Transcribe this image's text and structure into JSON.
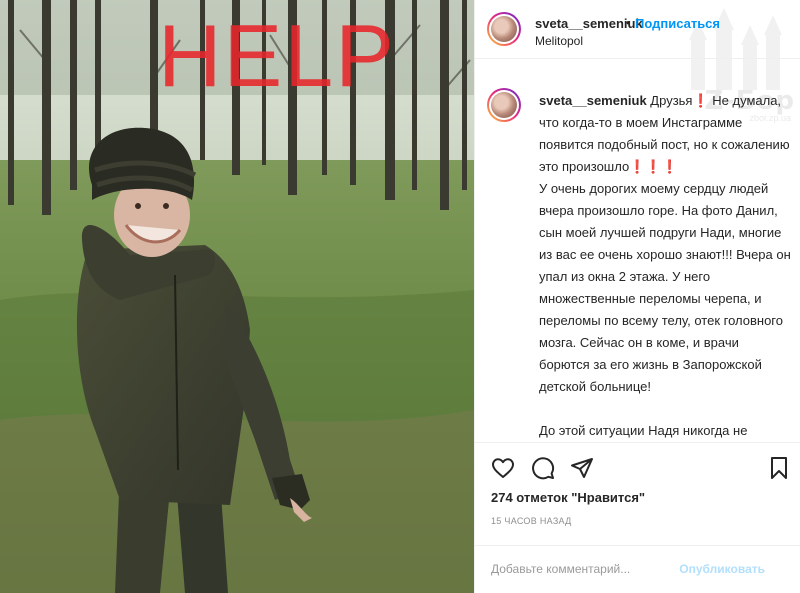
{
  "photo": {
    "overlay_text": "HELP",
    "overlay_color": "#e8262b"
  },
  "header": {
    "username": "sveta__semeniuk",
    "separator": "•",
    "follow_label": "Подписаться",
    "location": "Melitopol"
  },
  "watermark": {
    "logo_text": "Z-Бор",
    "sub_text": "zbor.zp.ua"
  },
  "caption": {
    "username": "sveta__semeniuk",
    "line1_start": " Друзья",
    "line1_rest": " Не думала, что когда-то в моем Инстаграмме появится подобный пост, но к сожалению это произошло",
    "excl": "❗",
    "excl_triple": "❗❗❗",
    "paragraph1_rest": "У очень дорогих моему сердцу людей вчера произошло горе. На фото Данил, сын моей лучшей подруги Нади, многие из вас ее очень хорошо знают!!! Вчера он упал из окна 2 этажа. У него множественные переломы черепа, и переломы по всему телу, отек головного мозга. Сейчас он в коме, и врачи борются за его жизнь в Запорожской детской больнице!",
    "paragraph2": "До этой ситуации Надя никогда не проходила мимо нуждающихся, всегда сочувствовала"
  },
  "actions": {
    "icons": [
      "heart-icon",
      "comment-icon",
      "share-icon",
      "bookmark-icon"
    ],
    "likes_text": "274 отметок \"Нравится\"",
    "time_text": "15 ЧАСОВ НАЗАД",
    "comment_placeholder": "Добавьте комментарий...",
    "publish_label": "Опубликовать"
  },
  "colors": {
    "link_blue": "#0095f6",
    "publish_disabled": "#b2dffc",
    "border": "#efefef",
    "text": "#262626",
    "muted": "#8e8e8e"
  }
}
